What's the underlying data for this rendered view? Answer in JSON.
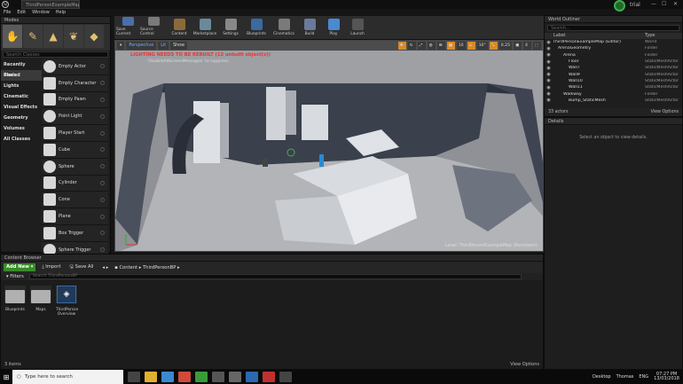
{
  "window": {
    "tab": "ThirdPersonExampleMap",
    "logo": "u"
  },
  "menu": [
    "File",
    "Edit",
    "Window",
    "Help"
  ],
  "trial": {
    "label": "trial",
    "controls": [
      "—",
      "☐",
      "✕"
    ]
  },
  "modes": {
    "title": "Modes",
    "search_placeholder": "Search Classes",
    "categories": [
      "Recently Placed",
      "Basic",
      "Lights",
      "Cinematic",
      "Visual Effects",
      "Geometry",
      "Volumes",
      "All Classes"
    ],
    "selected_category": "Basic",
    "actors": [
      "Empty Actor",
      "Empty Character",
      "Empty Pawn",
      "Point Light",
      "Player Start",
      "Cube",
      "Sphere",
      "Cylinder",
      "Cone",
      "Plane",
      "Box Trigger",
      "Sphere Trigger"
    ]
  },
  "toolbar": [
    {
      "label": "Save Current",
      "color": "#4a6fa8"
    },
    {
      "label": "Source Control",
      "color": "#7a7a7a"
    },
    {
      "label": "Content",
      "color": "#8a6a3a"
    },
    {
      "label": "Marketplace",
      "color": "#6a8a9a"
    },
    {
      "label": "Settings",
      "color": "#888888"
    },
    {
      "label": "Blueprints",
      "color": "#3a6aa0"
    },
    {
      "label": "Cinematics",
      "color": "#7a7a7a"
    },
    {
      "label": "Build",
      "color": "#6a7a9a"
    },
    {
      "label": "Play",
      "color": "#4a8ad0"
    },
    {
      "label": "Launch",
      "color": "#555555"
    }
  ],
  "viewport": {
    "perspective": "Perspective",
    "lit": "Lit",
    "show": "Show",
    "warning": "LIGHTING NEEDS TO BE REBUILT (13 unbuilt object(s))",
    "subwarning": "'DisableAllScreenMessages' to suppress",
    "level": "Level:  ThirdPersonExampleMap (Persistent)",
    "grid": "10",
    "angle": "10°",
    "scale": "0.25",
    "cams": "4"
  },
  "outliner": {
    "title": "World Outliner",
    "search_placeholder": "Search...",
    "col_label": "Label",
    "col_type": "Type",
    "rows": [
      {
        "name": "ThirdPersonExampleMap (Editor)",
        "type": "World",
        "indent": 0
      },
      {
        "name": "ArenaGeometry",
        "type": "Folder",
        "indent": 1
      },
      {
        "name": "Arena",
        "type": "Folder",
        "indent": 2
      },
      {
        "name": "Floor",
        "type": "StaticMeshActor",
        "indent": 3
      },
      {
        "name": "Wall7",
        "type": "StaticMeshActor",
        "indent": 3
      },
      {
        "name": "Wall9",
        "type": "StaticMeshActor",
        "indent": 3
      },
      {
        "name": "Wall10",
        "type": "StaticMeshActor",
        "indent": 3
      },
      {
        "name": "Wall11",
        "type": "StaticMeshActor",
        "indent": 3
      },
      {
        "name": "Walkway",
        "type": "Folder",
        "indent": 2
      },
      {
        "name": "Bump_StaticMesh",
        "type": "StaticMeshActor",
        "indent": 3
      }
    ],
    "count": "33 actors",
    "view_options": "View Options"
  },
  "details": {
    "title": "Details",
    "message": "Select an object to view details."
  },
  "content": {
    "title": "Content Browser",
    "add_new": "Add New",
    "import": "Import",
    "save_all": "Save All",
    "path": [
      "Content",
      "ThirdPersonBP"
    ],
    "filters": "Filters",
    "search_placeholder": "Search ThirdPersonBP",
    "assets": [
      {
        "name": "Blueprints",
        "kind": "folder"
      },
      {
        "name": "Maps",
        "kind": "folder"
      },
      {
        "name": "ThirdPerson Overview",
        "kind": "blueprint"
      }
    ],
    "item_count": "3 items",
    "view_options": "View Options"
  },
  "taskbar": {
    "search_placeholder": "Type here to search",
    "desktop": "Desktop",
    "user": "Thomas",
    "lang": "ENG",
    "time": "07:27 PM",
    "date": "13/03/2018"
  }
}
